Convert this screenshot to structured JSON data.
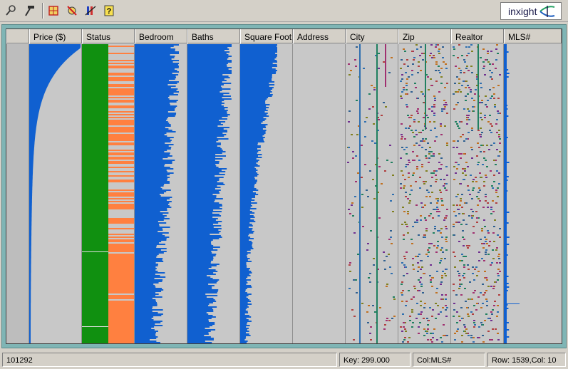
{
  "toolbar": {
    "tools": [
      {
        "icon": "magnifier-icon"
      },
      {
        "icon": "hammer-icon"
      },
      {
        "icon": "grid-select-icon"
      },
      {
        "icon": "clear-selection-icon"
      },
      {
        "icon": "column-filter-icon"
      },
      {
        "icon": "help-icon"
      }
    ],
    "logo_text": "inxight"
  },
  "table": {
    "columns": [
      {
        "label": "",
        "kind": "rowgutter"
      },
      {
        "label": "Price ($)",
        "kind": "curve"
      },
      {
        "label": "Status",
        "kind": "status"
      },
      {
        "label": "Bedroom",
        "kind": "bars"
      },
      {
        "label": "Baths",
        "kind": "bars"
      },
      {
        "label": "Square Foot",
        "kind": "bars_short"
      },
      {
        "label": "Address",
        "kind": "empty"
      },
      {
        "label": "City",
        "kind": "categorical"
      },
      {
        "label": "Zip",
        "kind": "categorical_dense"
      },
      {
        "label": "Realtor",
        "kind": "categorical_dense"
      },
      {
        "label": "MLS#",
        "kind": "mls"
      }
    ],
    "colors": {
      "bar": "#1060d0",
      "status_green": "#109010",
      "status_orange": "#ff8040",
      "cell_bg": "#cccccc",
      "category_palette": [
        "#a03070",
        "#306090",
        "#c07020",
        "#208060",
        "#703090",
        "#b04040",
        "#3070b0",
        "#808020"
      ]
    }
  },
  "statusbar": {
    "record": "101292",
    "key": "Key: 299.000",
    "col": "Col:MLS#",
    "rowcol": "Row: 1539,Col: 10"
  }
}
